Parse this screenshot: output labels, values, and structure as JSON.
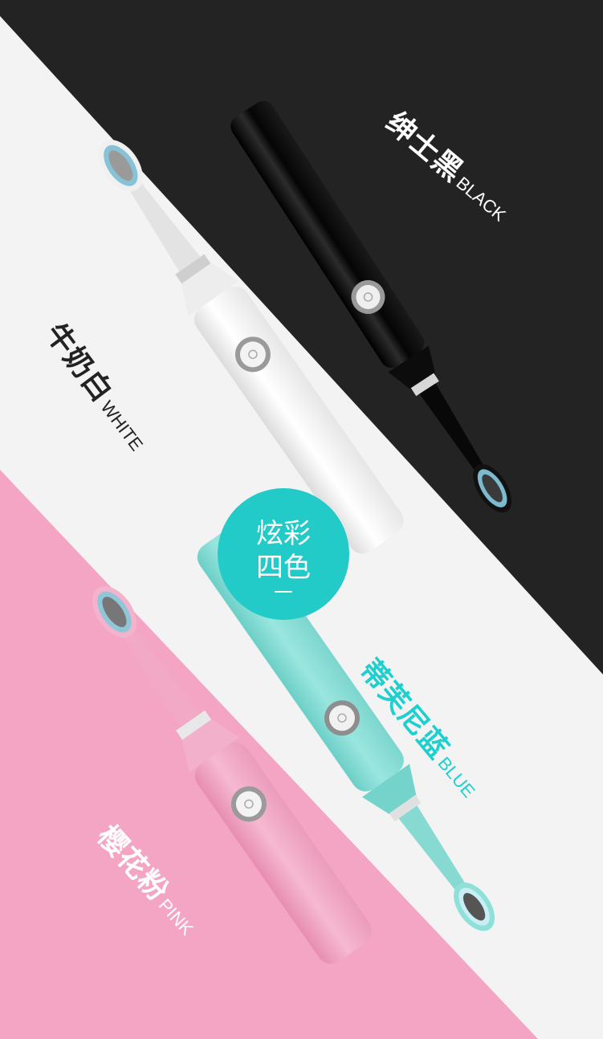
{
  "badge": {
    "line1": "炫彩",
    "line2": "四色"
  },
  "colors": {
    "black": {
      "cn": "绅士黑",
      "en": "BLACK",
      "brush": "#111111",
      "accent": "#ffffff"
    },
    "white": {
      "cn": "牛奶白",
      "en": "WHITE",
      "brush": "#f7f7f7",
      "accent": "#222222"
    },
    "blue": {
      "cn": "蒂芙尼蓝",
      "en": "BLUE",
      "brush": "#8fe0d9",
      "accent": "#1ecfcf"
    },
    "pink": {
      "cn": "樱花粉",
      "en": "PINK",
      "brush": "#f2a6c4",
      "accent": "#ffffff"
    }
  },
  "palette": {
    "background_black": "#232323",
    "background_white": "#f3f3f3",
    "background_pink": "#f5a5c4",
    "badge": "#22cac8"
  }
}
